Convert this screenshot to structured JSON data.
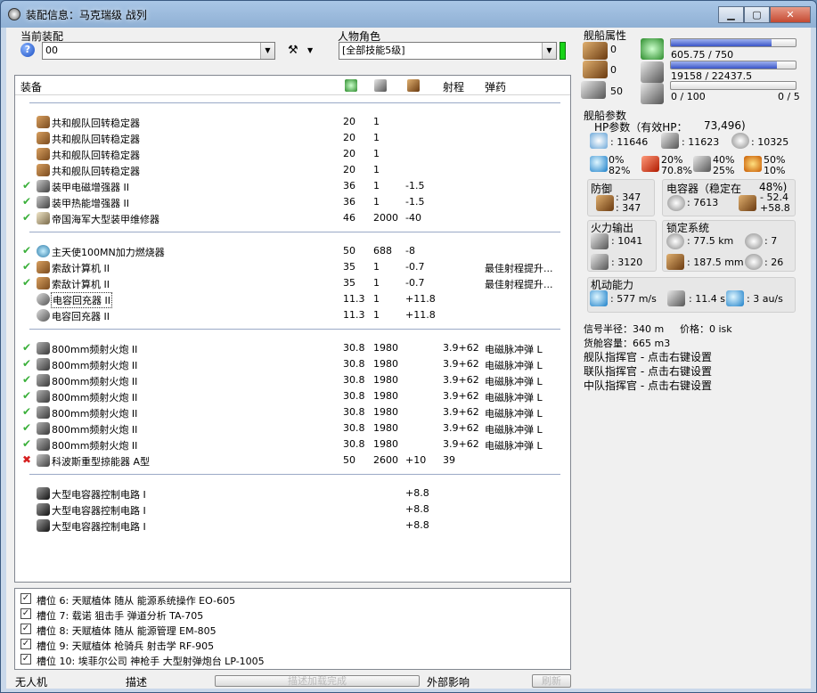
{
  "window": {
    "title": "装配信息：马克瑞级 战列",
    "min": "▁",
    "max": "▢",
    "close": "✕"
  },
  "fit": {
    "current_label": "当前装配",
    "current_value": "00",
    "character_label": "人物角色",
    "character_value": "[全部技能5级]"
  },
  "table": {
    "headers": {
      "equipment": "装备",
      "range": "射程",
      "ammo": "弹药"
    },
    "groups": [
      [
        {
          "status": "",
          "icon": "brown",
          "name": "共和舰队回转稳定器",
          "c1": "20",
          "c2": "1",
          "c3": "",
          "c4": "",
          "c5": ""
        },
        {
          "status": "",
          "icon": "brown",
          "name": "共和舰队回转稳定器",
          "c1": "20",
          "c2": "1",
          "c3": "",
          "c4": "",
          "c5": ""
        },
        {
          "status": "",
          "icon": "brown",
          "name": "共和舰队回转稳定器",
          "c1": "20",
          "c2": "1",
          "c3": "",
          "c4": "",
          "c5": ""
        },
        {
          "status": "",
          "icon": "brown",
          "name": "共和舰队回转稳定器",
          "c1": "20",
          "c2": "1",
          "c3": "",
          "c4": "",
          "c5": ""
        },
        {
          "status": "✔",
          "icon": "dark",
          "name": "装甲电磁增强器 II",
          "c1": "36",
          "c2": "1",
          "c3": "-1.5",
          "c4": "",
          "c5": ""
        },
        {
          "status": "✔",
          "icon": "dark",
          "name": "装甲热能增强器 II",
          "c1": "36",
          "c2": "1",
          "c3": "-1.5",
          "c4": "",
          "c5": ""
        },
        {
          "status": "✔",
          "icon": "metal",
          "name": "帝国海军大型装甲维修器",
          "c1": "46",
          "c2": "2000",
          "c3": "-40",
          "c4": "",
          "c5": ""
        }
      ],
      [
        {
          "status": "✔",
          "icon": "teal",
          "name": "主天使100MN加力燃烧器",
          "c1": "50",
          "c2": "688",
          "c3": "-8",
          "c4": "",
          "c5": ""
        },
        {
          "status": "✔",
          "icon": "brown",
          "name": "索敌计算机 II",
          "c1": "35",
          "c2": "1",
          "c3": "-0.7",
          "c4": "",
          "c5": "最佳射程提升..."
        },
        {
          "status": "✔",
          "icon": "brown",
          "name": "索敌计算机 II",
          "c1": "35",
          "c2": "1",
          "c3": "-0.7",
          "c4": "",
          "c5": "最佳射程提升..."
        },
        {
          "status": "",
          "icon": "cap",
          "name": "电容回充器 II",
          "c1": "11.3",
          "c2": "1",
          "c3": "+11.8",
          "c4": "",
          "c5": "",
          "focus": true
        },
        {
          "status": "",
          "icon": "cap",
          "name": "电容回充器 II",
          "c1": "11.3",
          "c2": "1",
          "c3": "+11.8",
          "c4": "",
          "c5": ""
        }
      ],
      [
        {
          "status": "✔",
          "icon": "gun",
          "name": "800mm频射火炮 II",
          "c1": "30.8",
          "c2": "1980",
          "c3": "",
          "c4": "3.9+62",
          "c5": "电磁脉冲弹 L"
        },
        {
          "status": "✔",
          "icon": "gun",
          "name": "800mm频射火炮 II",
          "c1": "30.8",
          "c2": "1980",
          "c3": "",
          "c4": "3.9+62",
          "c5": "电磁脉冲弹 L"
        },
        {
          "status": "✔",
          "icon": "gun",
          "name": "800mm频射火炮 II",
          "c1": "30.8",
          "c2": "1980",
          "c3": "",
          "c4": "3.9+62",
          "c5": "电磁脉冲弹 L"
        },
        {
          "status": "✔",
          "icon": "gun",
          "name": "800mm频射火炮 II",
          "c1": "30.8",
          "c2": "1980",
          "c3": "",
          "c4": "3.9+62",
          "c5": "电磁脉冲弹 L"
        },
        {
          "status": "✔",
          "icon": "gun",
          "name": "800mm频射火炮 II",
          "c1": "30.8",
          "c2": "1980",
          "c3": "",
          "c4": "3.9+62",
          "c5": "电磁脉冲弹 L"
        },
        {
          "status": "✔",
          "icon": "gun",
          "name": "800mm频射火炮 II",
          "c1": "30.8",
          "c2": "1980",
          "c3": "",
          "c4": "3.9+62",
          "c5": "电磁脉冲弹 L"
        },
        {
          "status": "✔",
          "icon": "gun",
          "name": "800mm频射火炮 II",
          "c1": "30.8",
          "c2": "1980",
          "c3": "",
          "c4": "3.9+62",
          "c5": "电磁脉冲弹 L"
        },
        {
          "status": "✖",
          "icon": "dark",
          "name": "科波斯重型掠能器 A型",
          "c1": "50",
          "c2": "2600",
          "c3": "+10",
          "c4": "39",
          "c5": ""
        }
      ],
      [
        {
          "status": "",
          "icon": "black",
          "name": "大型电容器控制电路 I",
          "c1": "",
          "c2": "",
          "c3": "+8.8",
          "c4": "",
          "c5": ""
        },
        {
          "status": "",
          "icon": "black",
          "name": "大型电容器控制电路 I",
          "c1": "",
          "c2": "",
          "c3": "+8.8",
          "c4": "",
          "c5": ""
        },
        {
          "status": "",
          "icon": "black",
          "name": "大型电容器控制电路 I",
          "c1": "",
          "c2": "",
          "c3": "+8.8",
          "c4": "",
          "c5": ""
        }
      ]
    ]
  },
  "implants": [
    {
      "checked": true,
      "text": "槽位 6: 天赋植体 随从 能源系统操作 EO-605"
    },
    {
      "checked": true,
      "text": "槽位 7: 载诺 狙击手 弹道分析 TA-705"
    },
    {
      "checked": true,
      "text": "槽位 8: 天赋植体 随从 能源管理 EM-805"
    },
    {
      "checked": true,
      "text": "槽位 9: 天赋植体 枪骑兵 射击学 RF-905"
    },
    {
      "checked": true,
      "text": "槽位 10: 埃菲尔公司 神枪手 大型射弹炮台 LP-1005"
    }
  ],
  "statusbar": {
    "drones": "无人机",
    "description": "描述",
    "progress": "描述加载完成",
    "external": "外部影响",
    "refresh": "刷新"
  },
  "ship_attrs": {
    "title": "舰船属性",
    "hardpoint_a": "0",
    "hardpoint_b": "0",
    "drone_bay": "50",
    "cpu": {
      "text": "605.75 / 750",
      "fraction": 0.81
    },
    "pg": {
      "text": "19158 / 22437.5",
      "fraction": 0.85
    },
    "calib": {
      "text": "0 / 100",
      "fraction": 0.0
    },
    "rig_slots": "0 / 5"
  },
  "ship_params": {
    "title": "舰船参数",
    "hp_label": "HP参数（有效HP：",
    "hp_value": "73,496)",
    "shield": ": 11646",
    "armor": ": 11623",
    "hull": ": 10325",
    "res": [
      {
        "a": "0%",
        "b": "82%"
      },
      {
        "a": "20%",
        "b": "70.8%"
      },
      {
        "a": "40%",
        "b": "25%"
      },
      {
        "a": "50%",
        "b": "10%"
      }
    ],
    "defense": {
      "title": "防御",
      "a": ": 347",
      "b": ": 347"
    },
    "capacitor": {
      "title": "电容器（稳定在",
      "pct": "48%)",
      "value": ": 7613",
      "delta1": "- 52.4",
      "delta2": "+58.8"
    },
    "firepower": {
      "title": "火力输出",
      "a": ": 1041",
      "b": ": 3120"
    },
    "targeting": {
      "title": "锁定系统",
      "range": ": 77.5 km",
      "targets": ": 7",
      "res": ": 187.5 mm",
      "scan": ": 26"
    },
    "mobility": {
      "title": "机动能力",
      "speed": ": 577 m/s",
      "align": ": 11.4 s",
      "warp": ": 3 au/s"
    },
    "signature": "信号半径：340 m",
    "price": "价格：0 isk",
    "cargo": "货舱容量：665 m3",
    "fleet": "舰队指挥官 - 点击右键设置",
    "wing": "联队指挥官 - 点击右键设置",
    "squad": "中队指挥官 - 点击右键设置"
  }
}
